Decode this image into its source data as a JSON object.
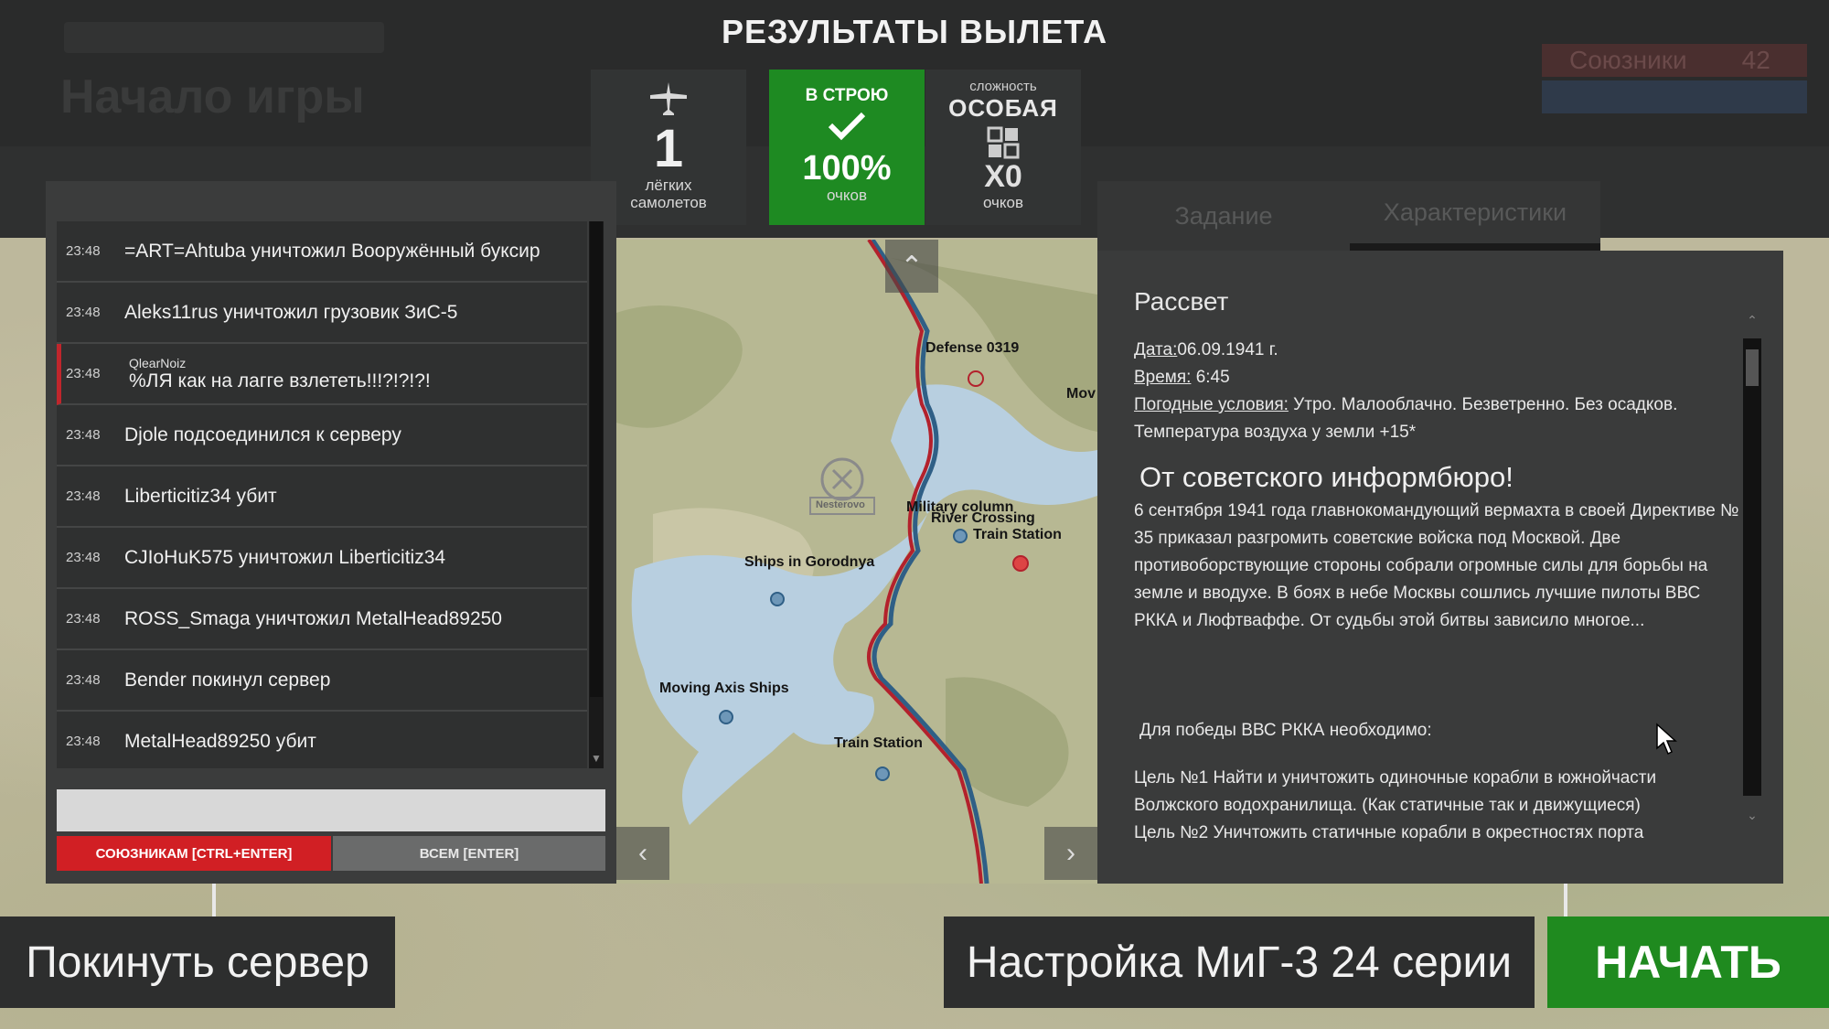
{
  "header": {
    "title": "РЕЗУЛЬТАТЫ ВЫЛЕТА",
    "ghost_title": "Начало игры",
    "ghost_score_label": "Союзники",
    "ghost_score_value": "42"
  },
  "stats": {
    "planes": {
      "value": "1",
      "label_line1": "лёгких",
      "label_line2": "самолетов",
      "icon": "plane-icon"
    },
    "status": {
      "header": "В СТРОЮ",
      "icon": "checkmark-icon",
      "percent": "100%",
      "label": "очков",
      "color": "#1e8a22"
    },
    "difficulty": {
      "header": "сложность",
      "level": "ОСОБАЯ",
      "icon": "grid-icon",
      "multiplier": "X0",
      "label": "очков"
    }
  },
  "chat": {
    "messages": [
      {
        "time": "23:48",
        "text": "=ART=Ahtuba уничтожил Вооружённый буксир"
      },
      {
        "time": "23:48",
        "text": "Aleks11rus уничтожил грузовик ЗиС-5"
      },
      {
        "time": "23:48",
        "author": "QlearNoiz",
        "text": "%ЛЯ как на лагге взлететь!!!?!?!?!"
      },
      {
        "time": "23:48",
        "text": "Djole подсоединился к серверу"
      },
      {
        "time": "23:48",
        "text": "Liberticitiz34 убит"
      },
      {
        "time": "23:48",
        "text": "CJIoHuK575 уничтожил Liberticitiz34"
      },
      {
        "time": "23:48",
        "text": "ROSS_Smaga уничтожил MetalHead89250"
      },
      {
        "time": "23:48",
        "text": "Bender покинул сервер"
      },
      {
        "time": "23:48",
        "text": "MetalHead89250 убит"
      }
    ],
    "input_value": "",
    "send_allies_label": "СОЮЗНИКАМ [CTRL+ENTER]",
    "send_all_label": "ВСЕМ [ENTER]",
    "accent_color": "#d11f24"
  },
  "map": {
    "labels": {
      "defense": "Defense 0319",
      "mov": "Mov",
      "military": "Military column",
      "river": "River Crossing",
      "train1": "Train Station",
      "ships_gorodnya": "Ships in Gorodnya",
      "moving_axis": "Moving Axis Ships",
      "train2": "Train Station",
      "nesterovo": "Nesterovo"
    },
    "nav_up": "up-arrow-icon",
    "nav_left": "left-arrow-icon",
    "nav_right": "right-arrow-icon"
  },
  "tabs": [
    {
      "label": "Задание"
    },
    {
      "label": "Характеристики"
    }
  ],
  "briefing": {
    "title": "Рассвет",
    "date_label": "Дата:",
    "date_value": "06.09.1941 г.",
    "time_label": "Время:",
    "time_value": " 6:45",
    "weather_label": "Погодные условия:",
    "weather_value": " Утро. Малооблачно. Безветренно. Без осадков.",
    "temperature": "Температура воздуха у земли +15*",
    "heading": "От советского информбюро!",
    "paragraph": "6 сентября 1941 года главнокомандующий вермахта в своей Директиве № 35 приказал разгромить советские войска под Москвой. Две противоборствующие стороны собрали огромные силы для борьбы на земле и вводухе. В боях в небе Москвы сошлись лучшие пилоты ВВС РККА и Люфтваффе.  От судьбы этой битвы зависило многое...",
    "goal_header": "Для победы ВВС РККА необходимо:",
    "goal1": "Цель №1  Найти и уничтожить одиночные корабли в южнойчасти Волжского водохранилища. (Как статичные так и движущиеся)",
    "goal2": "Цель №2  Уничтожить статичные корабли в окрестностях порта"
  },
  "footer": {
    "leave_label": "Покинуть сервер",
    "setup_label": "Настройка МиГ-3 24 серии",
    "start_label": "НАЧАТЬ",
    "start_color": "#1f8a1f"
  }
}
